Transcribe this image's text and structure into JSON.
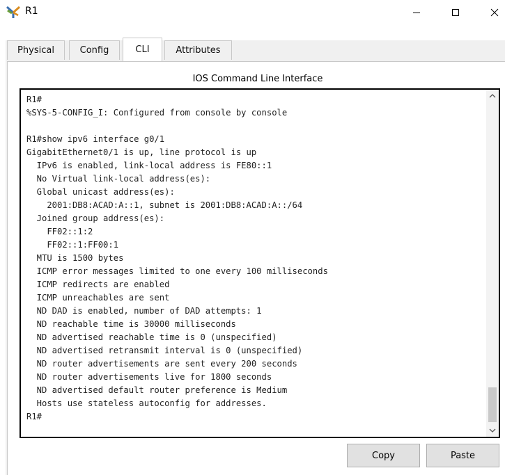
{
  "window": {
    "title": "R1",
    "icon": "router-device-icon"
  },
  "tabs": [
    {
      "label": "Physical",
      "active": false
    },
    {
      "label": "Config",
      "active": false
    },
    {
      "label": "CLI",
      "active": true
    },
    {
      "label": "Attributes",
      "active": false
    }
  ],
  "panel": {
    "title": "IOS Command Line Interface"
  },
  "terminal": {
    "lines": [
      "R1#",
      "%SYS-5-CONFIG_I: Configured from console by console",
      "",
      "R1#show ipv6 interface g0/1",
      "GigabitEthernet0/1 is up, line protocol is up",
      "  IPv6 is enabled, link-local address is FE80::1",
      "  No Virtual link-local address(es):",
      "  Global unicast address(es):",
      "    2001:DB8:ACAD:A::1, subnet is 2001:DB8:ACAD:A::/64",
      "  Joined group address(es):",
      "    FF02::1:2",
      "    FF02::1:FF00:1",
      "  MTU is 1500 bytes",
      "  ICMP error messages limited to one every 100 milliseconds",
      "  ICMP redirects are enabled",
      "  ICMP unreachables are sent",
      "  ND DAD is enabled, number of DAD attempts: 1",
      "  ND reachable time is 30000 milliseconds",
      "  ND advertised reachable time is 0 (unspecified)",
      "  ND advertised retransmit interval is 0 (unspecified)",
      "  ND router advertisements are sent every 200 seconds",
      "  ND router advertisements live for 1800 seconds",
      "  ND advertised default router preference is Medium",
      "  Hosts use stateless autoconfig for addresses.",
      "R1#"
    ]
  },
  "buttons": {
    "copy": "Copy",
    "paste": "Paste"
  }
}
